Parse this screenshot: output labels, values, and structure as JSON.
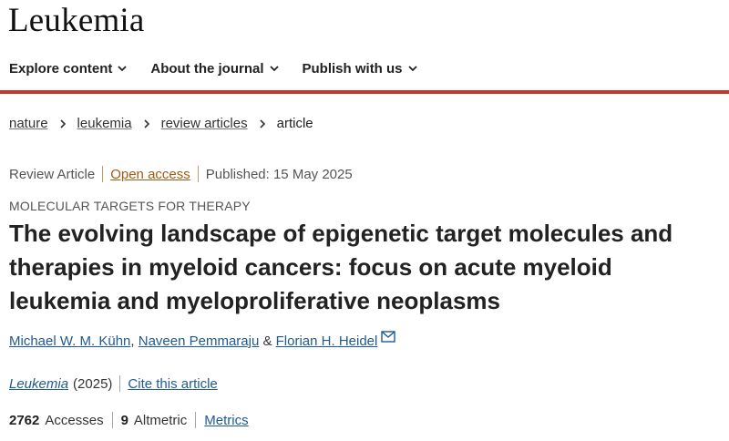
{
  "header": {
    "logo_text": "Leukemia"
  },
  "nav": {
    "items": [
      {
        "label": "Explore content"
      },
      {
        "label": "About the journal"
      },
      {
        "label": "Publish with us"
      }
    ],
    "accent_color": "#c0392b"
  },
  "breadcrumb": {
    "items": [
      "nature",
      "leukemia",
      "review articles"
    ],
    "current": "article"
  },
  "article": {
    "type": "Review Article",
    "access": "Open access",
    "published": "Published: 15 May 2025",
    "subject": "MOLECULAR TARGETS FOR THERAPY",
    "title": "The evolving landscape of epigenetic target molecules and therapies in myeloid cancers: focus on acute myeloid leukemia and myeloproliferative neoplasms",
    "authors": {
      "a1": "Michael W. M. Kühn",
      "comma": ", ",
      "a2": "Naveen Pemmaraju",
      "amp": " & ",
      "a3": "Florian H. Heidel"
    },
    "journal": "Leukemia",
    "year": "(2025)",
    "cite_label": "Cite this article"
  },
  "metrics": {
    "accesses_count": "2762",
    "accesses_label": "Accesses",
    "altmetric_count": "9",
    "altmetric_label": "Altmetric",
    "metrics_link": "Metrics"
  }
}
